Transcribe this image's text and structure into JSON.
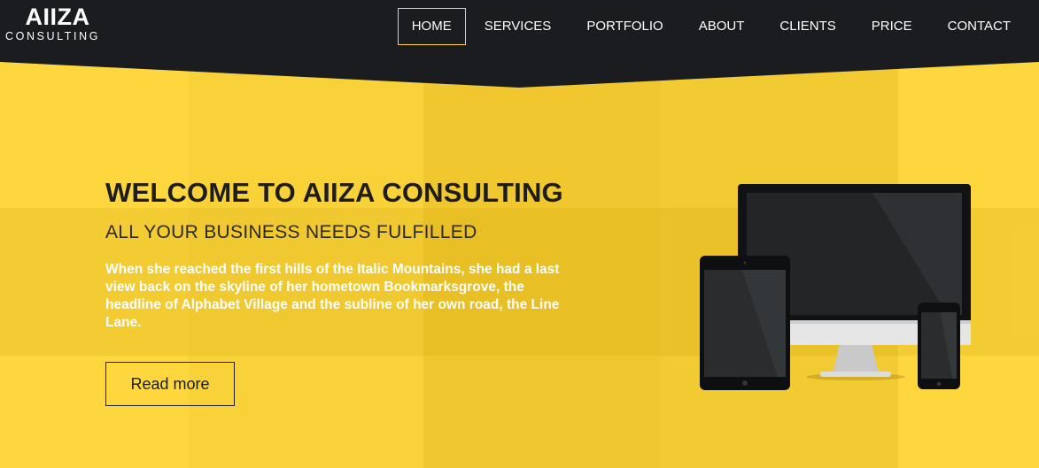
{
  "brand": {
    "name": "AIIZA",
    "tagline": "CONSULTING"
  },
  "nav": {
    "items": [
      {
        "label": "HOME",
        "active": true
      },
      {
        "label": "SERVICES",
        "active": false
      },
      {
        "label": "PORTFOLIO",
        "active": false
      },
      {
        "label": "ABOUT",
        "active": false
      },
      {
        "label": "CLIENTS",
        "active": false
      },
      {
        "label": "PRICE",
        "active": false
      },
      {
        "label": "CONTACT",
        "active": false
      }
    ]
  },
  "hero": {
    "title": "WELCOME TO AIIZA CONSULTING",
    "subtitle": "ALL YOUR BUSINESS NEEDS FULFILLED",
    "text": "When she reached the first hills of the Italic Mountains, she had a last view back on the skyline of her hometown Bookmarksgrove, the headline of Alphabet Village and the subline of her own road, the Line Lane.",
    "button_label": "Read more"
  },
  "colors": {
    "header_bg": "#1a1c1f",
    "accent": "#fdd73d",
    "accent_dark": "#e9c22b"
  },
  "icons": [
    "desktop-monitor-icon",
    "tablet-icon",
    "smartphone-icon"
  ]
}
